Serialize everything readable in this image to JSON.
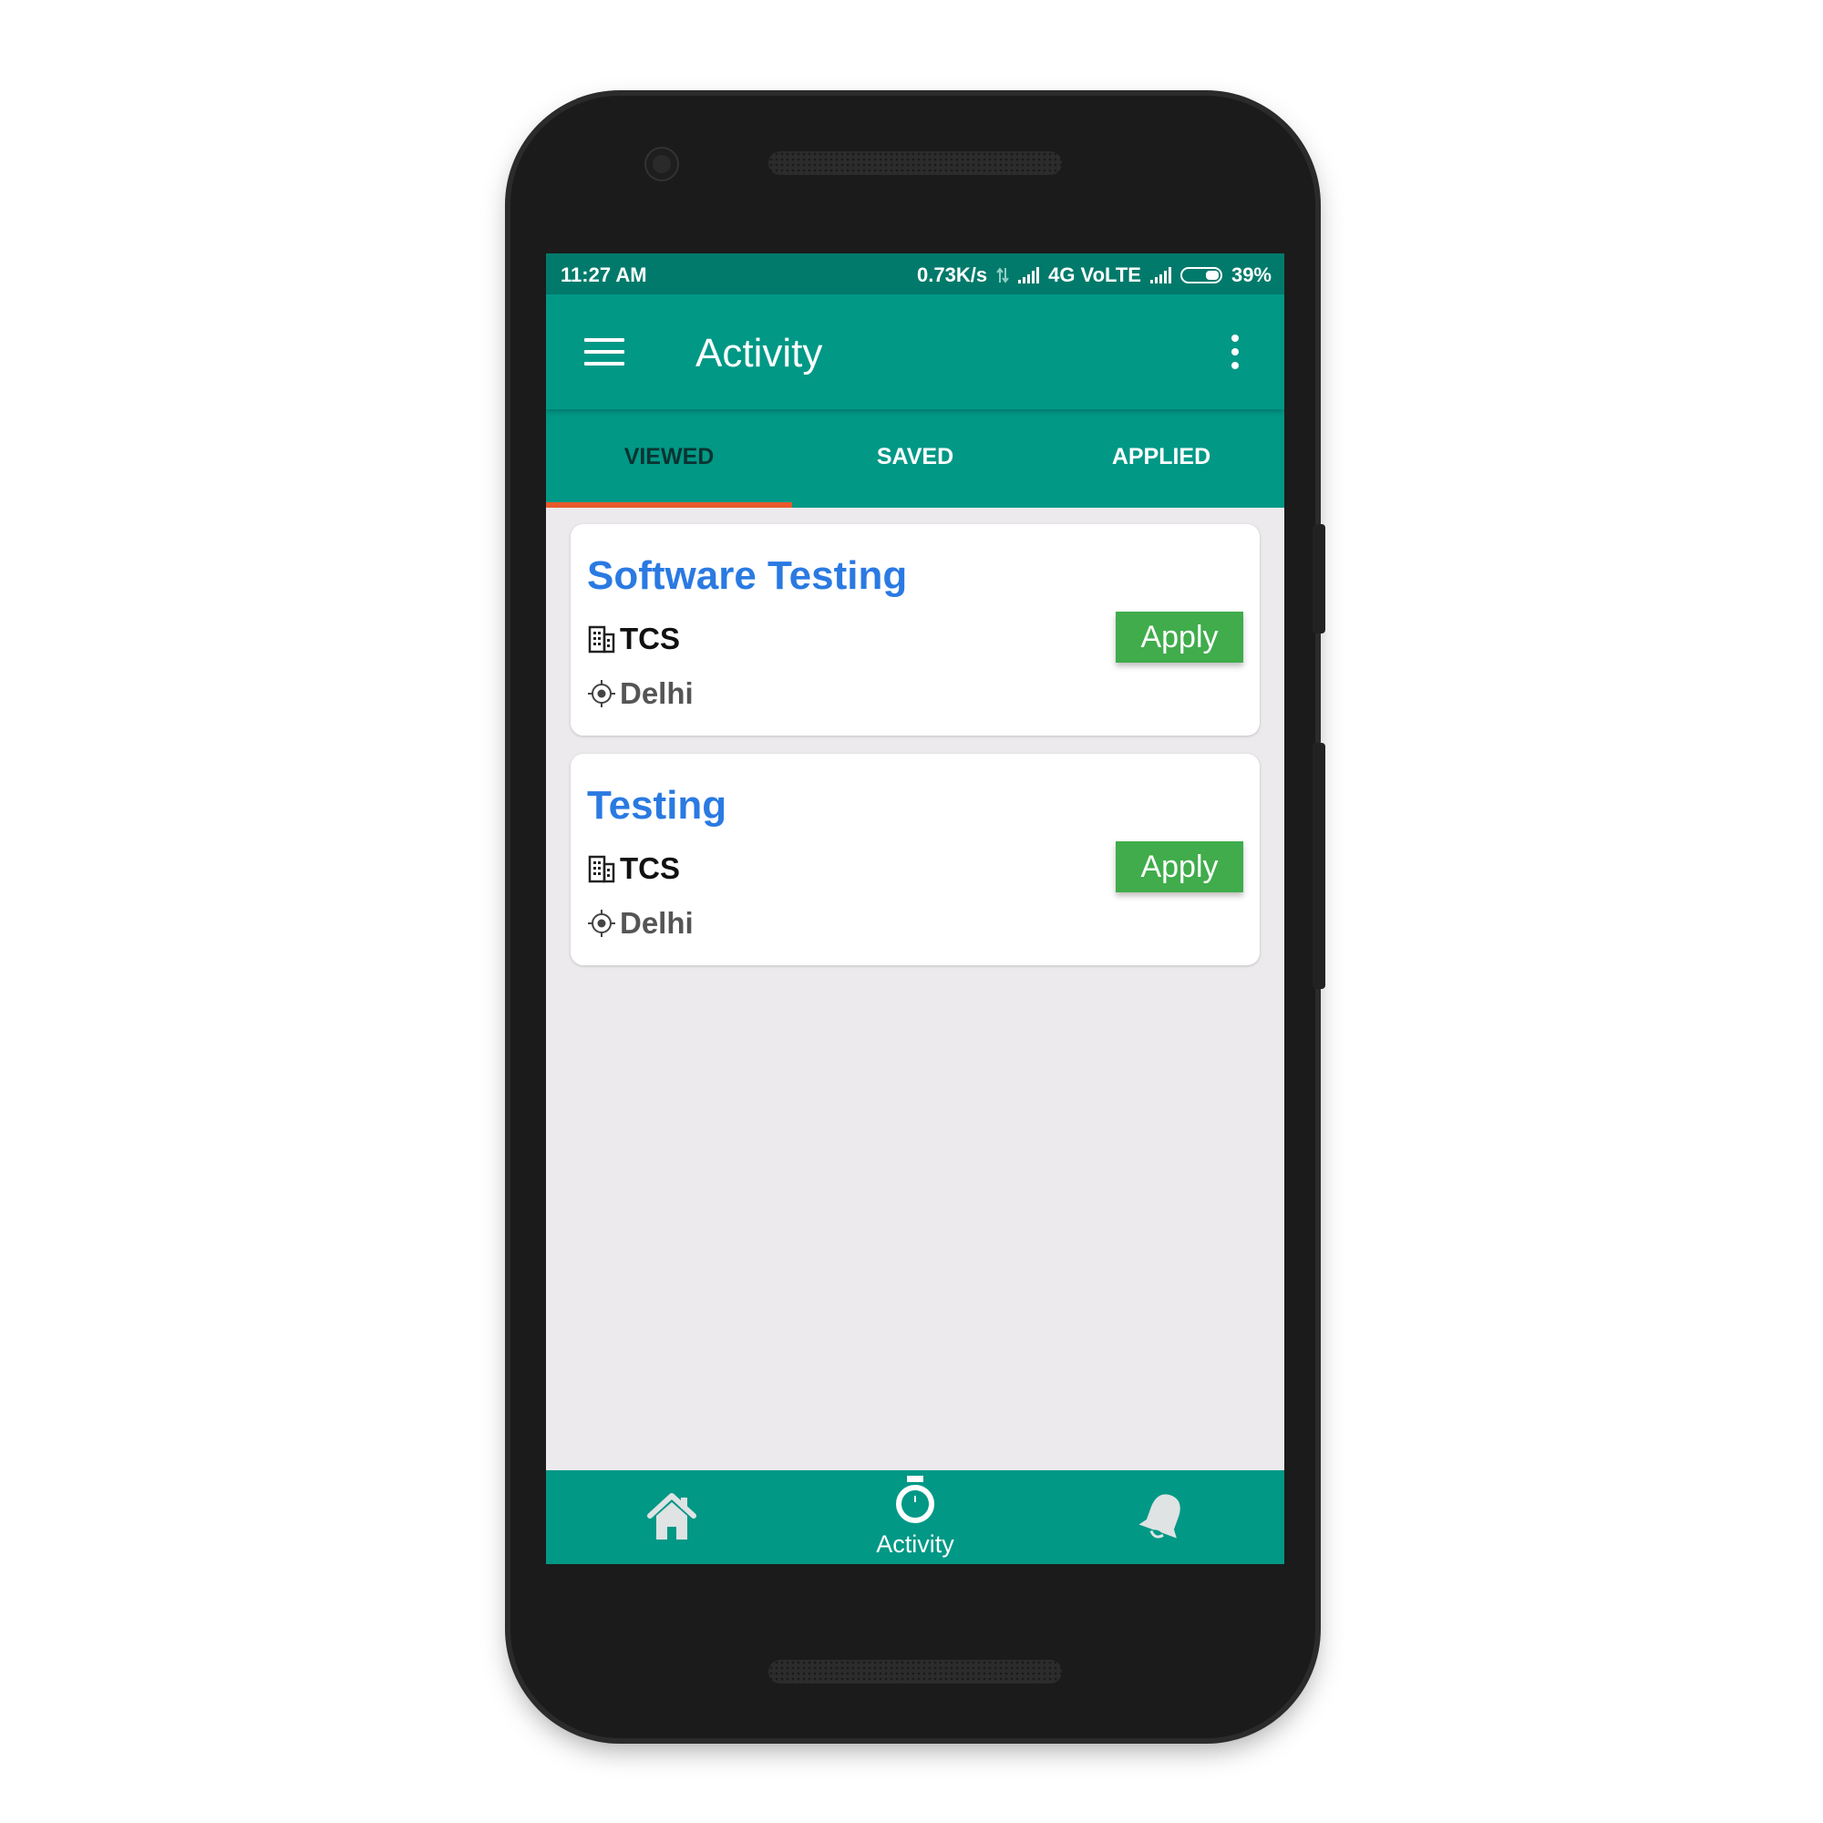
{
  "status_bar": {
    "time": "11:27 AM",
    "speed": "0.73K/s",
    "network": "4G VoLTE",
    "battery": "39%"
  },
  "app_bar": {
    "title": "Activity",
    "menu_icon": "hamburger-menu-icon",
    "overflow_icon": "more-vert-icon"
  },
  "tabs": [
    {
      "label": "VIEWED",
      "active": true
    },
    {
      "label": "SAVED",
      "active": false
    },
    {
      "label": "APPLIED",
      "active": false
    }
  ],
  "jobs": [
    {
      "title": "Software Testing",
      "company": "TCS",
      "location": "Delhi",
      "action": "Apply"
    },
    {
      "title": "Testing",
      "company": "TCS",
      "location": "Delhi",
      "action": "Apply"
    }
  ],
  "bottom_nav": [
    {
      "icon": "home-icon",
      "label": ""
    },
    {
      "icon": "stopwatch-icon",
      "label": "Activity",
      "active": true
    },
    {
      "icon": "bell-icon",
      "label": ""
    }
  ],
  "colors": {
    "primary": "#019886",
    "status_bar": "#017a6b",
    "tab_indicator": "#e8592b",
    "job_title": "#2a7ae2",
    "apply_button": "#40ac4b",
    "background": "#eceaec"
  }
}
